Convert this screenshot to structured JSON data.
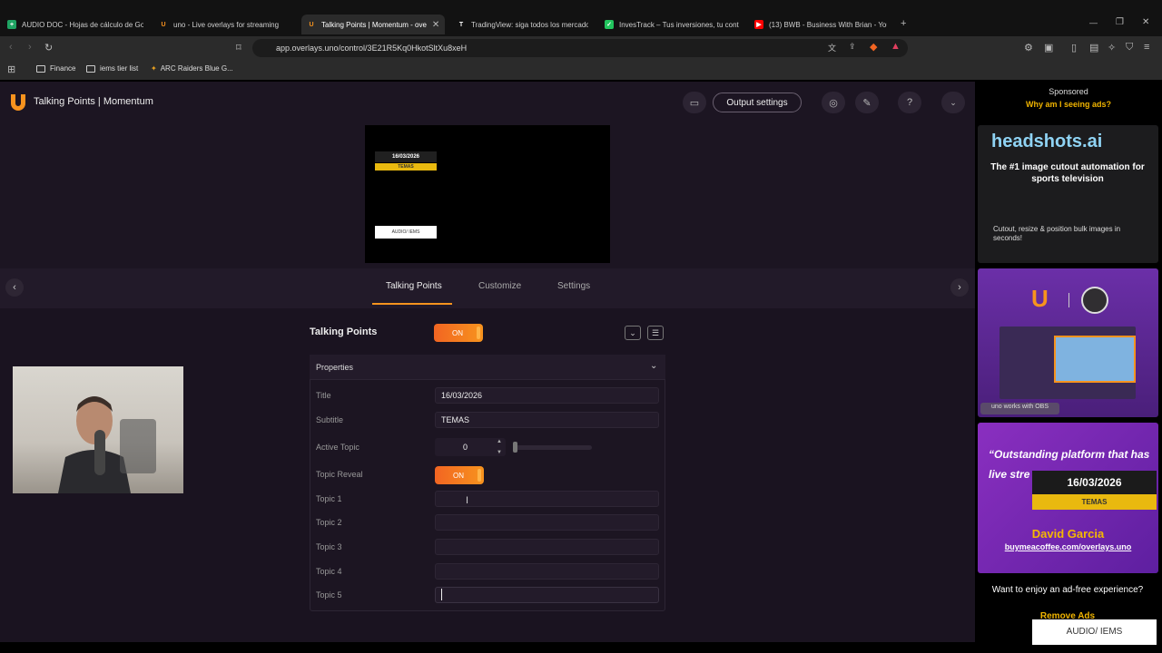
{
  "browser": {
    "tabs": [
      {
        "label": "AUDIO DOC - Hojas de cálculo de Go",
        "icon": "sheets-icon",
        "color": "#1fa463"
      },
      {
        "label": "uno - Live overlays for streaming",
        "icon": "uno-icon",
        "color": "#f7931e"
      },
      {
        "label": "Talking Points | Momentum - ove",
        "icon": "uno-icon",
        "color": "#f7931e",
        "active": true
      },
      {
        "label": "TradingView: siga todos los mercado",
        "icon": "tradingview-icon",
        "color": "#ffffff"
      },
      {
        "label": "InvesTrack – Tus inversiones, tu cont",
        "icon": "investrack-icon",
        "color": "#22c55e"
      },
      {
        "label": "(13) BWB - Business With Brian - You",
        "icon": "youtube-icon",
        "color": "#ff0000"
      }
    ],
    "url": "app.overlays.uno/control/3E21R5Kq0HkotSltXu8xeH",
    "bookmarks": [
      "Finance",
      "iems tier list",
      "ARC Raiders Blue G..."
    ]
  },
  "header": {
    "title": "Talking Points | Momentum",
    "output_settings": "Output settings"
  },
  "preview": {
    "date": "16/03/2026",
    "subtitle": "TEMAS",
    "audio": "AUDIO/ IEMS"
  },
  "content_tabs": [
    "Talking Points",
    "Customize",
    "Settings"
  ],
  "section": {
    "title": "Talking Points",
    "toggle": "ON"
  },
  "properties": {
    "label": "Properties",
    "fields": {
      "title_label": "Title",
      "title_value": "16/03/2026",
      "subtitle_label": "Subtitle",
      "subtitle_value": "TEMAS",
      "active_topic_label": "Active Topic",
      "active_topic_value": "0",
      "topic_reveal_label": "Topic Reveal",
      "topic_reveal_value": "ON"
    },
    "topics": [
      {
        "label": "Topic 1",
        "value": ""
      },
      {
        "label": "Topic 2",
        "value": ""
      },
      {
        "label": "Topic 3",
        "value": ""
      },
      {
        "label": "Topic 4",
        "value": ""
      },
      {
        "label": "Topic 5",
        "value": ""
      }
    ]
  },
  "ads": {
    "sponsored": "Sponsored",
    "why": "Why am I seeing ads?",
    "ad1_brand": "headshots.ai",
    "ad1_headline": "The #1 image cutout automation for sports television",
    "ad1_text": "Cutout, resize & position bulk images in seconds!",
    "ad2_badge": "uno works with OBS",
    "ad3_quote": "“Outstanding platform that has live stre",
    "ad3_date": "16/03/2026",
    "ad3_sub": "TEMAS",
    "ad3_name": "David Garcia",
    "ad3_link": "buymeacoffee.com/overlays.uno",
    "adfree": "Want to enjoy an ad-free experience?",
    "remove": "Remove Ads",
    "audio_tag": "AUDIO/ IEMS"
  }
}
